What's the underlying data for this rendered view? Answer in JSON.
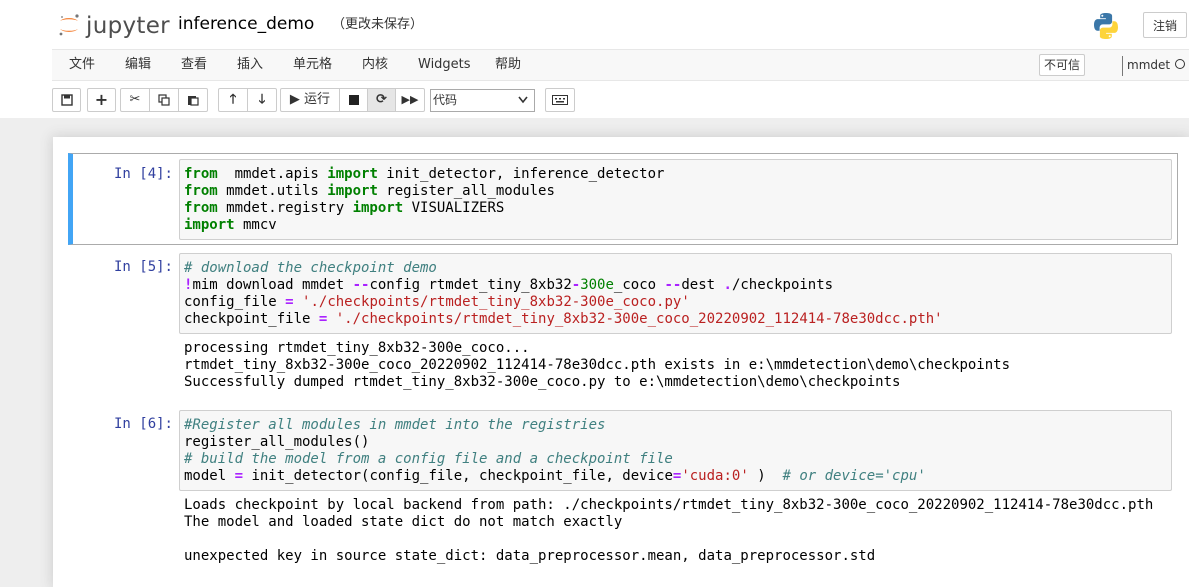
{
  "header": {
    "logo_text": "jupyter",
    "notebook_title": "inference_demo",
    "save_status": "（更改未保存）",
    "logout_label": "注销"
  },
  "menu": {
    "items": [
      "文件",
      "编辑",
      "查看",
      "插入",
      "单元格",
      "内核",
      "Widgets",
      "帮助"
    ],
    "trust_label": "不可信",
    "kernel_name": "mmdet"
  },
  "toolbar": {
    "run_label": "▶ 运行",
    "cell_type": "代码"
  },
  "cells": [
    {
      "prompt": "In [4]:",
      "code": [
        [
          [
            "kw",
            "from"
          ],
          [
            "",
            "  mmdet.apis "
          ],
          [
            "kw",
            "import"
          ],
          [
            "",
            " init_detector, inference_detector"
          ]
        ],
        [
          [
            "kw",
            "from"
          ],
          [
            "",
            " mmdet.utils "
          ],
          [
            "kw",
            "import"
          ],
          [
            "",
            " register_all_modules"
          ]
        ],
        [
          [
            "kw",
            "from"
          ],
          [
            "",
            " mmdet.registry "
          ],
          [
            "kw",
            "import"
          ],
          [
            "",
            " VISUALIZERS"
          ]
        ],
        [
          [
            "kw",
            "import"
          ],
          [
            "",
            " mmcv"
          ]
        ]
      ],
      "output": []
    },
    {
      "prompt": "In [5]:",
      "code": [
        [
          [
            "cm",
            "# download the checkpoint demo"
          ]
        ],
        [
          [
            "op",
            "!"
          ],
          [
            "",
            "mim download mmdet "
          ],
          [
            "op",
            "--"
          ],
          [
            "",
            "config rtmdet_tiny_8xb32"
          ],
          [
            "op",
            "-"
          ],
          [
            "nu",
            "300e"
          ],
          [
            "",
            "_coco "
          ],
          [
            "op",
            "--"
          ],
          [
            "",
            "dest "
          ],
          [
            "op",
            "."
          ],
          [
            "",
            "/checkpoints"
          ]
        ],
        [
          [
            "",
            "config_file "
          ],
          [
            "op",
            "="
          ],
          [
            "",
            " "
          ],
          [
            "st",
            "'./checkpoints/rtmdet_tiny_8xb32-300e_coco.py'"
          ]
        ],
        [
          [
            "",
            "checkpoint_file "
          ],
          [
            "op",
            "="
          ],
          [
            "",
            " "
          ],
          [
            "st",
            "'./checkpoints/rtmdet_tiny_8xb32-300e_coco_20220902_112414-78e30dcc.pth'"
          ]
        ]
      ],
      "output": [
        "processing rtmdet_tiny_8xb32-300e_coco...",
        "rtmdet_tiny_8xb32-300e_coco_20220902_112414-78e30dcc.pth exists in e:\\mmdetection\\demo\\checkpoints",
        "Successfully dumped rtmdet_tiny_8xb32-300e_coco.py to e:\\mmdetection\\demo\\checkpoints"
      ]
    },
    {
      "prompt": "In [6]:",
      "code": [
        [
          [
            "cm",
            "#Register all modules in mmdet into the registries"
          ]
        ],
        [
          [
            "",
            "register_all_modules()"
          ]
        ],
        [
          [
            "cm",
            "# build the model from a config file and a checkpoint file"
          ]
        ],
        [
          [
            "",
            "model "
          ],
          [
            "op",
            "="
          ],
          [
            "",
            " init_detector(config_file, checkpoint_file, device"
          ],
          [
            "op",
            "="
          ],
          [
            "st",
            "'cuda:0'"
          ],
          [
            "",
            " )  "
          ],
          [
            "cm",
            "# or device='cpu'"
          ]
        ]
      ],
      "output": [
        "Loads checkpoint by local backend from path: ./checkpoints/rtmdet_tiny_8xb32-300e_coco_20220902_112414-78e30dcc.pth",
        "The model and loaded state dict do not match exactly",
        "",
        "unexpected key in source state_dict: data_preprocessor.mean, data_preprocessor.std"
      ]
    }
  ]
}
